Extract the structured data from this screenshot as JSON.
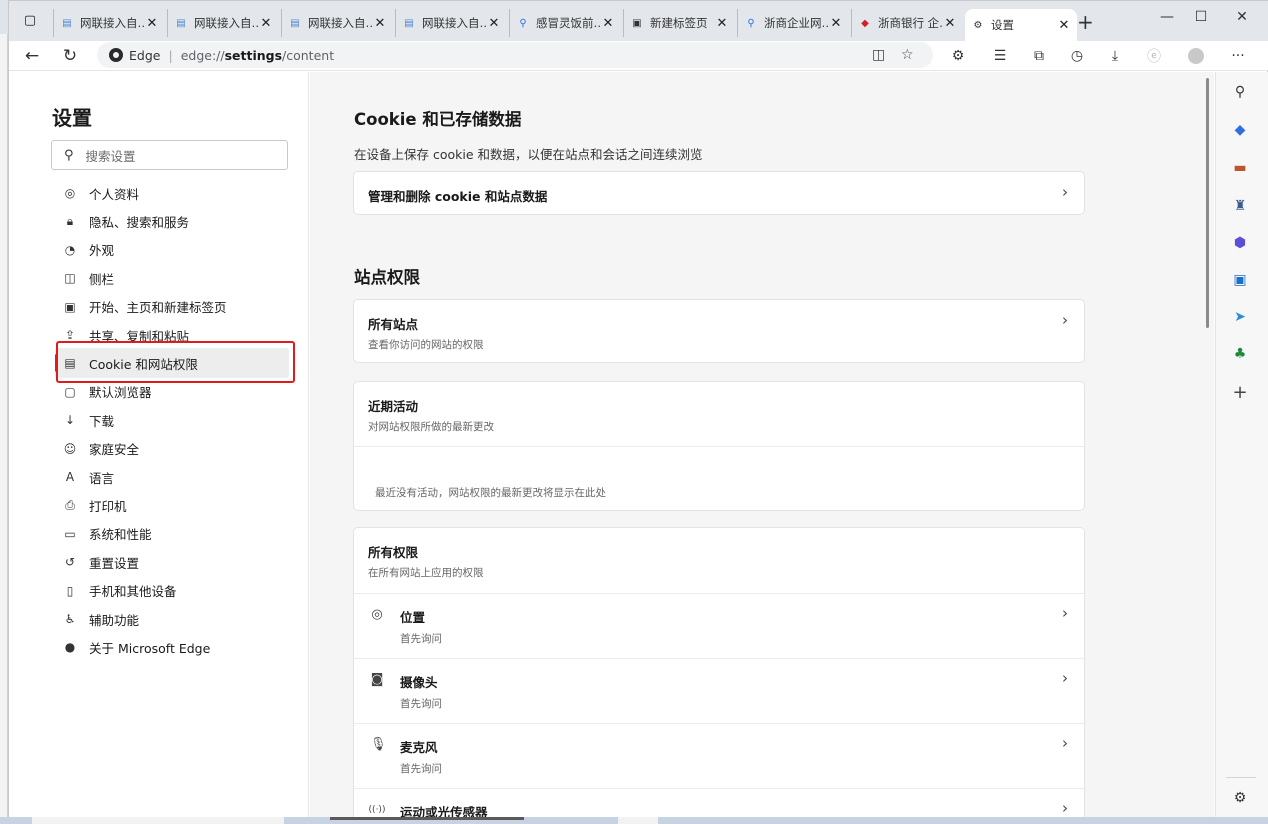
{
  "window": {
    "tabs": [
      {
        "label": "网联接入自…",
        "icon": "doc-icon"
      },
      {
        "label": "网联接入自…",
        "icon": "doc-icon"
      },
      {
        "label": "网联接入自…",
        "icon": "doc-icon"
      },
      {
        "label": "网联接入自…",
        "icon": "doc-icon"
      },
      {
        "label": "感冒灵饭前…",
        "icon": "search-icon"
      },
      {
        "label": "新建标签页",
        "icon": "newtab-icon"
      },
      {
        "label": "浙商企业网…",
        "icon": "search-icon"
      },
      {
        "label": "浙商银行 企…",
        "icon": "bank-logo"
      },
      {
        "label": "设置",
        "icon": "gear-icon"
      }
    ],
    "close_glyph": "✕",
    "new_tab_glyph": "+"
  },
  "address": {
    "brand": "Edge",
    "separator": "|",
    "url_prefix": "edge://",
    "url_bold": "settings",
    "url_suffix": "/content"
  },
  "settings_nav": {
    "title": "设置",
    "search_placeholder": "搜索设置",
    "items": [
      {
        "label": "个人资料",
        "icon": "profile-icon",
        "glyph": "◎"
      },
      {
        "label": "隐私、搜索和服务",
        "icon": "lock-icon",
        "glyph": "🔒︎"
      },
      {
        "label": "外观",
        "icon": "palette-icon",
        "glyph": "◔"
      },
      {
        "label": "侧栏",
        "icon": "sidebar-icon",
        "glyph": "◫"
      },
      {
        "label": "开始、主页和新建标签页",
        "icon": "home-icon",
        "glyph": "▣"
      },
      {
        "label": "共享、复制和粘贴",
        "icon": "share-icon",
        "glyph": "⇪"
      },
      {
        "label": "Cookie 和网站权限",
        "icon": "cookie-icon",
        "glyph": "▤"
      },
      {
        "label": "默认浏览器",
        "icon": "browser-icon",
        "glyph": "▢"
      },
      {
        "label": "下载",
        "icon": "download-icon",
        "glyph": "↓"
      },
      {
        "label": "家庭安全",
        "icon": "family-icon",
        "glyph": "☺"
      },
      {
        "label": "语言",
        "icon": "language-icon",
        "glyph": "A"
      },
      {
        "label": "打印机",
        "icon": "printer-icon",
        "glyph": "⎙"
      },
      {
        "label": "系统和性能",
        "icon": "system-icon",
        "glyph": "▭"
      },
      {
        "label": "重置设置",
        "icon": "reset-icon",
        "glyph": "↺"
      },
      {
        "label": "手机和其他设备",
        "icon": "phone-icon",
        "glyph": "▯"
      },
      {
        "label": "辅助功能",
        "icon": "accessibility-icon",
        "glyph": "♿︎"
      },
      {
        "label": "关于 Microsoft Edge",
        "icon": "edge-icon",
        "glyph": "●"
      }
    ],
    "selected_index": 6
  },
  "content": {
    "cookie_section": {
      "title": "Cookie 和已存储数据",
      "description": "在设备上保存 cookie 和数据，以便在站点和会话之间连续浏览",
      "manage_row": "管理和删除 cookie 和站点数据"
    },
    "site_permissions": {
      "title": "站点权限",
      "all_sites": {
        "title": "所有站点",
        "sub": "查看你访问的网站的权限"
      },
      "recent_activity": {
        "title": "近期活动",
        "sub": "对网站权限所做的最新更改",
        "empty": "最近没有活动，网站权限的最新更改将显示在此处"
      },
      "all_permissions": {
        "title": "所有权限",
        "sub": "在所有网站上应用的权限"
      },
      "permissions": [
        {
          "title": "位置",
          "sub": "首先询问",
          "icon": "location-icon",
          "glyph": "◎"
        },
        {
          "title": "摄像头",
          "sub": "首先询问",
          "icon": "camera-icon",
          "glyph": "◙"
        },
        {
          "title": "麦克风",
          "sub": "首先询问",
          "icon": "microphone-icon",
          "glyph": "🎙︎"
        },
        {
          "title": "运动或光传感器",
          "sub": "",
          "icon": "sensor-icon",
          "glyph": "((·))"
        }
      ]
    }
  },
  "colors": {
    "accent": "#0f6cbd",
    "highlight_box": "#e01b1b"
  }
}
